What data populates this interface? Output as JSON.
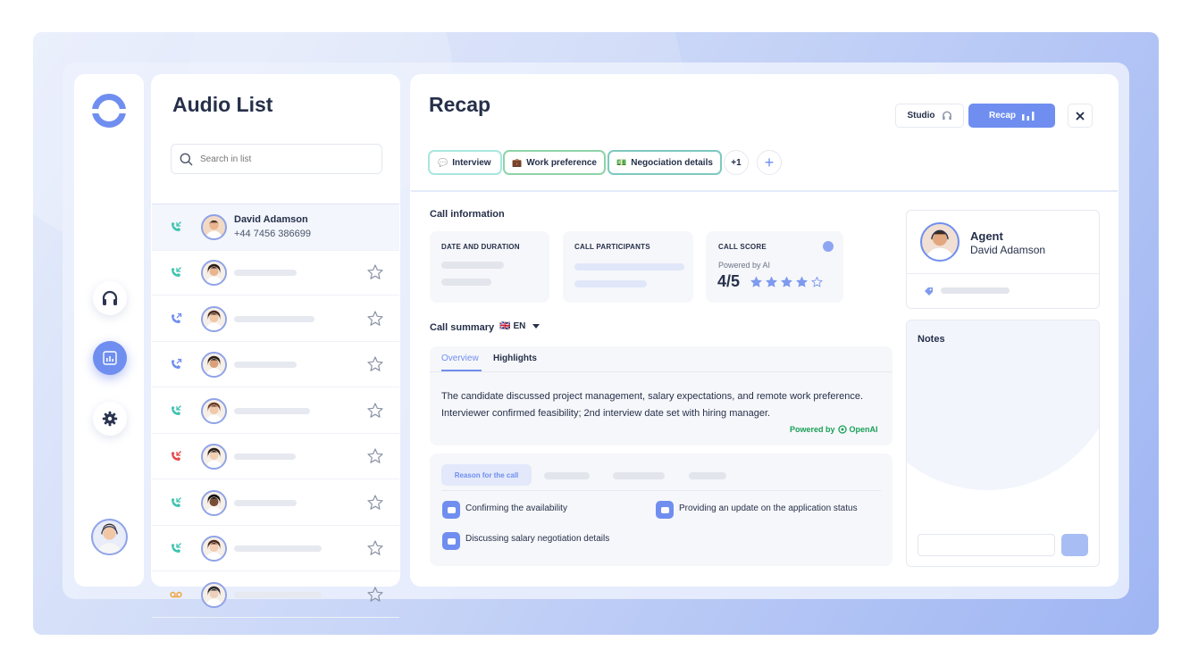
{
  "colors": {
    "accent": "#6f8ef0",
    "teal": "#3ec3b0",
    "red": "#e5484d",
    "orange": "#f0a43a",
    "openai_green": "#18a058"
  },
  "nav": {
    "icons": [
      "headphones-icon",
      "chart-icon",
      "gear-icon"
    ],
    "active": "chart-icon"
  },
  "list": {
    "title": "Audio List",
    "search_placeholder": "Search in list",
    "selected": {
      "name": "David Adamson",
      "phone": "+44 7456 386699"
    },
    "rows": [
      {
        "call_type": "incoming",
        "color": "#3ec3b0"
      },
      {
        "call_type": "outgoing",
        "color": "#6f8ef0"
      },
      {
        "call_type": "outgoing",
        "color": "#6f8ef0"
      },
      {
        "call_type": "incoming",
        "color": "#3ec3b0"
      },
      {
        "call_type": "missed",
        "color": "#e5484d"
      },
      {
        "call_type": "incoming",
        "color": "#3ec3b0"
      },
      {
        "call_type": "incoming",
        "color": "#3ec3b0"
      },
      {
        "call_type": "voicemail",
        "color": "#f0a43a"
      }
    ]
  },
  "recap": {
    "title": "Recap",
    "studio_label": "Studio",
    "recap_label": "Recap",
    "tags": [
      {
        "label": "Interview",
        "icon": "💬"
      },
      {
        "label": "Work preference",
        "icon": "💼"
      },
      {
        "label": "Negociation details",
        "icon": "💵"
      }
    ],
    "more_tags": "+1",
    "add_tag": "+",
    "call_info": {
      "title": "Call information",
      "date_label": "DATE AND DURATION",
      "participants_label": "CALL PARTICIPANTS",
      "score_label": "CALL SCORE",
      "powered": "Powered by AI",
      "score": "4/5",
      "stars_filled": 4,
      "stars_total": 5
    },
    "summary": {
      "title": "Call summary",
      "flag": "🇬🇧",
      "lang": "EN",
      "tabs": [
        "Overview",
        "Highlights"
      ],
      "text": "The candidate discussed project management, salary expectations, and remote work preference. Interviewer confirmed feasibility; 2nd interview date set with hiring manager.",
      "powered_by": "Powered by",
      "provider": "OpenAI"
    },
    "reasons": {
      "tab": "Reason for the call",
      "items": [
        "Confirming the availability",
        "Providing an update on the application status",
        "Discussing salary negotiation details"
      ]
    }
  },
  "agent": {
    "label": "Agent",
    "name": "David Adamson"
  },
  "notes": {
    "title": "Notes"
  }
}
